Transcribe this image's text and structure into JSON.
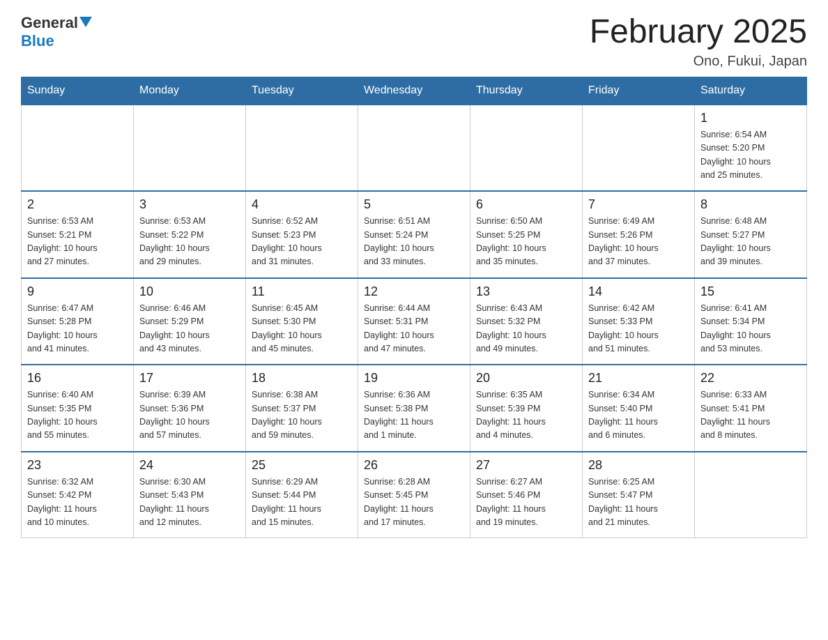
{
  "header": {
    "logo": {
      "general": "General",
      "blue": "Blue"
    },
    "title": "February 2025",
    "location": "Ono, Fukui, Japan"
  },
  "days_of_week": [
    "Sunday",
    "Monday",
    "Tuesday",
    "Wednesday",
    "Thursday",
    "Friday",
    "Saturday"
  ],
  "weeks": [
    [
      {
        "day": "",
        "info": ""
      },
      {
        "day": "",
        "info": ""
      },
      {
        "day": "",
        "info": ""
      },
      {
        "day": "",
        "info": ""
      },
      {
        "day": "",
        "info": ""
      },
      {
        "day": "",
        "info": ""
      },
      {
        "day": "1",
        "info": "Sunrise: 6:54 AM\nSunset: 5:20 PM\nDaylight: 10 hours\nand 25 minutes."
      }
    ],
    [
      {
        "day": "2",
        "info": "Sunrise: 6:53 AM\nSunset: 5:21 PM\nDaylight: 10 hours\nand 27 minutes."
      },
      {
        "day": "3",
        "info": "Sunrise: 6:53 AM\nSunset: 5:22 PM\nDaylight: 10 hours\nand 29 minutes."
      },
      {
        "day": "4",
        "info": "Sunrise: 6:52 AM\nSunset: 5:23 PM\nDaylight: 10 hours\nand 31 minutes."
      },
      {
        "day": "5",
        "info": "Sunrise: 6:51 AM\nSunset: 5:24 PM\nDaylight: 10 hours\nand 33 minutes."
      },
      {
        "day": "6",
        "info": "Sunrise: 6:50 AM\nSunset: 5:25 PM\nDaylight: 10 hours\nand 35 minutes."
      },
      {
        "day": "7",
        "info": "Sunrise: 6:49 AM\nSunset: 5:26 PM\nDaylight: 10 hours\nand 37 minutes."
      },
      {
        "day": "8",
        "info": "Sunrise: 6:48 AM\nSunset: 5:27 PM\nDaylight: 10 hours\nand 39 minutes."
      }
    ],
    [
      {
        "day": "9",
        "info": "Sunrise: 6:47 AM\nSunset: 5:28 PM\nDaylight: 10 hours\nand 41 minutes."
      },
      {
        "day": "10",
        "info": "Sunrise: 6:46 AM\nSunset: 5:29 PM\nDaylight: 10 hours\nand 43 minutes."
      },
      {
        "day": "11",
        "info": "Sunrise: 6:45 AM\nSunset: 5:30 PM\nDaylight: 10 hours\nand 45 minutes."
      },
      {
        "day": "12",
        "info": "Sunrise: 6:44 AM\nSunset: 5:31 PM\nDaylight: 10 hours\nand 47 minutes."
      },
      {
        "day": "13",
        "info": "Sunrise: 6:43 AM\nSunset: 5:32 PM\nDaylight: 10 hours\nand 49 minutes."
      },
      {
        "day": "14",
        "info": "Sunrise: 6:42 AM\nSunset: 5:33 PM\nDaylight: 10 hours\nand 51 minutes."
      },
      {
        "day": "15",
        "info": "Sunrise: 6:41 AM\nSunset: 5:34 PM\nDaylight: 10 hours\nand 53 minutes."
      }
    ],
    [
      {
        "day": "16",
        "info": "Sunrise: 6:40 AM\nSunset: 5:35 PM\nDaylight: 10 hours\nand 55 minutes."
      },
      {
        "day": "17",
        "info": "Sunrise: 6:39 AM\nSunset: 5:36 PM\nDaylight: 10 hours\nand 57 minutes."
      },
      {
        "day": "18",
        "info": "Sunrise: 6:38 AM\nSunset: 5:37 PM\nDaylight: 10 hours\nand 59 minutes."
      },
      {
        "day": "19",
        "info": "Sunrise: 6:36 AM\nSunset: 5:38 PM\nDaylight: 11 hours\nand 1 minute."
      },
      {
        "day": "20",
        "info": "Sunrise: 6:35 AM\nSunset: 5:39 PM\nDaylight: 11 hours\nand 4 minutes."
      },
      {
        "day": "21",
        "info": "Sunrise: 6:34 AM\nSunset: 5:40 PM\nDaylight: 11 hours\nand 6 minutes."
      },
      {
        "day": "22",
        "info": "Sunrise: 6:33 AM\nSunset: 5:41 PM\nDaylight: 11 hours\nand 8 minutes."
      }
    ],
    [
      {
        "day": "23",
        "info": "Sunrise: 6:32 AM\nSunset: 5:42 PM\nDaylight: 11 hours\nand 10 minutes."
      },
      {
        "day": "24",
        "info": "Sunrise: 6:30 AM\nSunset: 5:43 PM\nDaylight: 11 hours\nand 12 minutes."
      },
      {
        "day": "25",
        "info": "Sunrise: 6:29 AM\nSunset: 5:44 PM\nDaylight: 11 hours\nand 15 minutes."
      },
      {
        "day": "26",
        "info": "Sunrise: 6:28 AM\nSunset: 5:45 PM\nDaylight: 11 hours\nand 17 minutes."
      },
      {
        "day": "27",
        "info": "Sunrise: 6:27 AM\nSunset: 5:46 PM\nDaylight: 11 hours\nand 19 minutes."
      },
      {
        "day": "28",
        "info": "Sunrise: 6:25 AM\nSunset: 5:47 PM\nDaylight: 11 hours\nand 21 minutes."
      },
      {
        "day": "",
        "info": ""
      }
    ]
  ]
}
